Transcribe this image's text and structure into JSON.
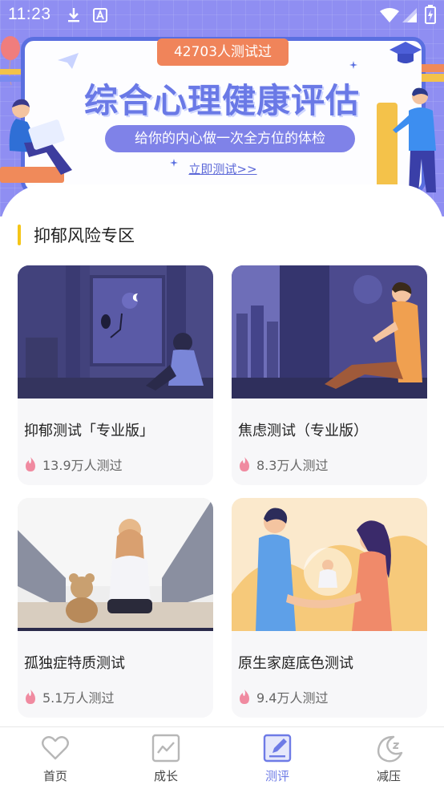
{
  "status_bar": {
    "time": "11:23",
    "icons": [
      "download-icon",
      "a-icon",
      "wifi-icon",
      "signal-icon",
      "battery-icon"
    ]
  },
  "banner": {
    "test_count": "42703人测试过",
    "title": "综合心理健康评估",
    "subtitle": "给你的内心做一次全方位的体检",
    "cta": "立即测试>>"
  },
  "section": {
    "title": "抑郁风险专区",
    "accent_color": "#f5c518"
  },
  "cards": [
    {
      "title": "抑郁测试「专业版」",
      "count": "13.9万人测过"
    },
    {
      "title": "焦虑测试（专业版）",
      "count": "8.3万人测过"
    },
    {
      "title": "孤独症特质测试",
      "count": "5.1万人测过"
    },
    {
      "title": "原生家庭底色测试",
      "count": "9.4万人测过"
    }
  ],
  "nav": {
    "items": [
      {
        "label": "首页",
        "icon": "heart-icon"
      },
      {
        "label": "成长",
        "icon": "chart-icon"
      },
      {
        "label": "测评",
        "icon": "edit-icon"
      },
      {
        "label": "减压",
        "icon": "moon-icon"
      }
    ],
    "active": "测评",
    "active_color": "#6e7be6"
  }
}
